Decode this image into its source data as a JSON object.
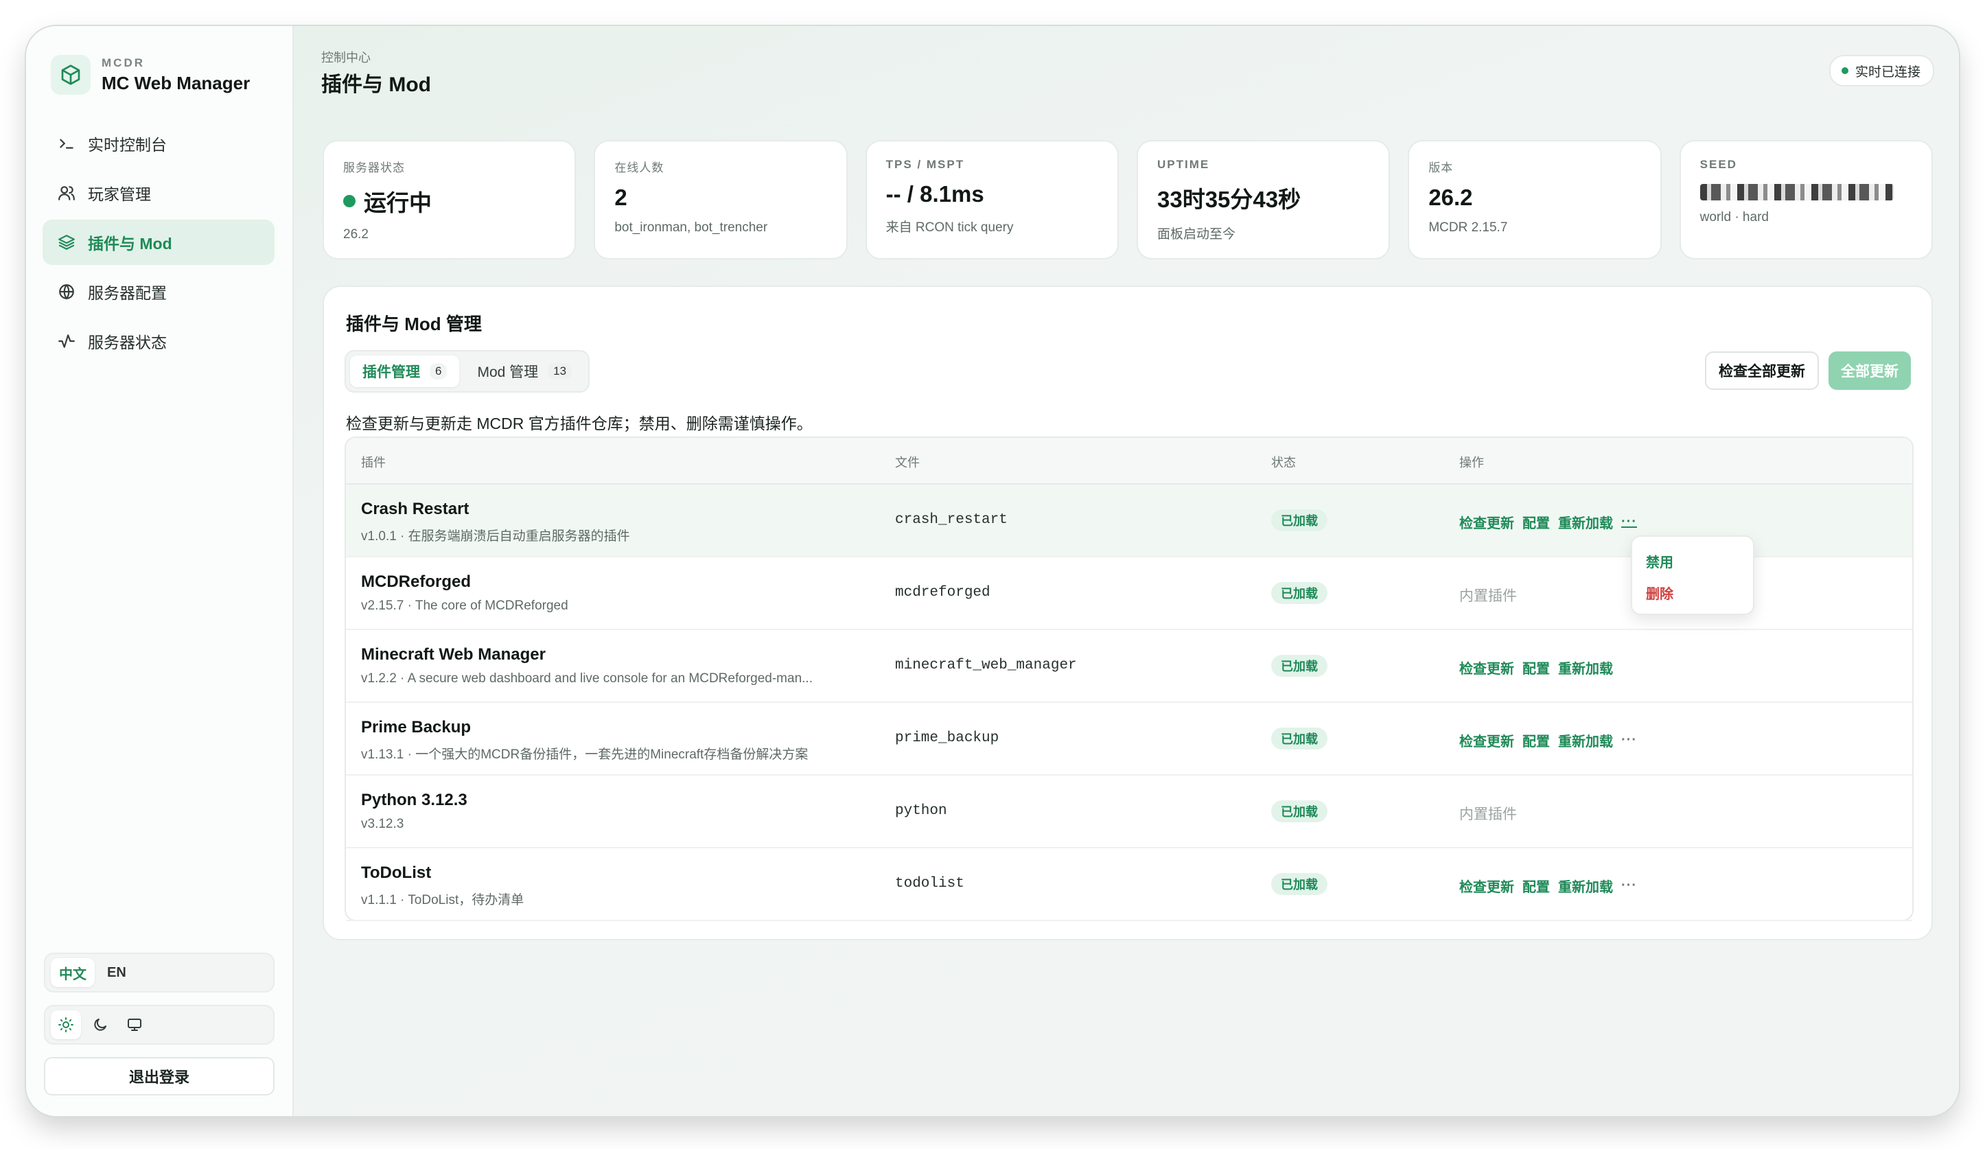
{
  "brand": {
    "small": "MCDR",
    "title": "MC Web Manager"
  },
  "nav": [
    {
      "label": "实时控制台",
      "icon": "terminal-icon"
    },
    {
      "label": "玩家管理",
      "icon": "users-icon"
    },
    {
      "label": "插件与 Mod",
      "icon": "layers-icon",
      "active": true
    },
    {
      "label": "服务器配置",
      "icon": "globe-icon"
    },
    {
      "label": "服务器状态",
      "icon": "activity-icon"
    }
  ],
  "lang": {
    "zh": "中文",
    "en": "EN"
  },
  "logout": "退出登录",
  "header": {
    "crumb": "控制中心",
    "title": "插件与 Mod",
    "connection": "实时已连接"
  },
  "stats": [
    {
      "label": "服务器状态",
      "value": "运行中",
      "sub": "26.2"
    },
    {
      "label": "在线人数",
      "value": "2",
      "sub": "bot_ironman, bot_trencher"
    },
    {
      "label": "TPS / MSPT",
      "value": "-- / 8.1ms",
      "sub": "来自 RCON tick query"
    },
    {
      "label": "UPTIME",
      "value": "33时35分43秒",
      "sub": "面板启动至今"
    },
    {
      "label": "版本",
      "value": "26.2",
      "sub": "MCDR 2.15.7"
    },
    {
      "label": "SEED",
      "sub": "world · hard"
    }
  ],
  "panel": {
    "title": "插件与 Mod 管理",
    "tabs": [
      {
        "label": "插件管理",
        "count": "6"
      },
      {
        "label": "Mod 管理",
        "count": "13"
      }
    ],
    "check_all": "检查全部更新",
    "update_all": "全部更新",
    "hint": "检查更新与更新走 MCDR 官方插件仓库；禁用、删除需谨慎操作。",
    "columns": {
      "plugin": "插件",
      "file": "文件",
      "status": "状态",
      "ops": "操作"
    },
    "rows": [
      {
        "name": "Crash Restart",
        "desc": "v1.0.1 · 在服务端崩溃后自动重启服务器的插件",
        "file": "crash_restart",
        "status": "已加载"
      },
      {
        "name": "MCDReforged",
        "desc": "v2.15.7 · The core of MCDReforged",
        "file": "mcdreforged",
        "status": "已加载",
        "builtin": "内置插件"
      },
      {
        "name": "Minecraft Web Manager",
        "desc": "v1.2.2 · A secure web dashboard and live console for an MCDReforged-man...",
        "file": "minecraft_web_manager",
        "status": "已加载"
      },
      {
        "name": "Prime Backup",
        "desc": "v1.13.1 · 一个强大的MCDR备份插件，一套先进的Minecraft存档备份解决方案",
        "file": "prime_backup",
        "status": "已加载"
      },
      {
        "name": "Python 3.12.3",
        "desc": "v3.12.3",
        "file": "python",
        "status": "已加载",
        "builtin": "内置插件"
      },
      {
        "name": "ToDoList",
        "desc": "v1.1.1 · ToDoList，待办清单",
        "file": "todolist",
        "status": "已加载"
      }
    ],
    "ops": {
      "check": "检查更新",
      "config": "配置",
      "reload": "重新加载",
      "more": "···"
    },
    "menu": {
      "disable": "禁用",
      "delete": "删除"
    }
  },
  "colors": {
    "accent": "#1f8a58",
    "danger": "#d04040"
  }
}
